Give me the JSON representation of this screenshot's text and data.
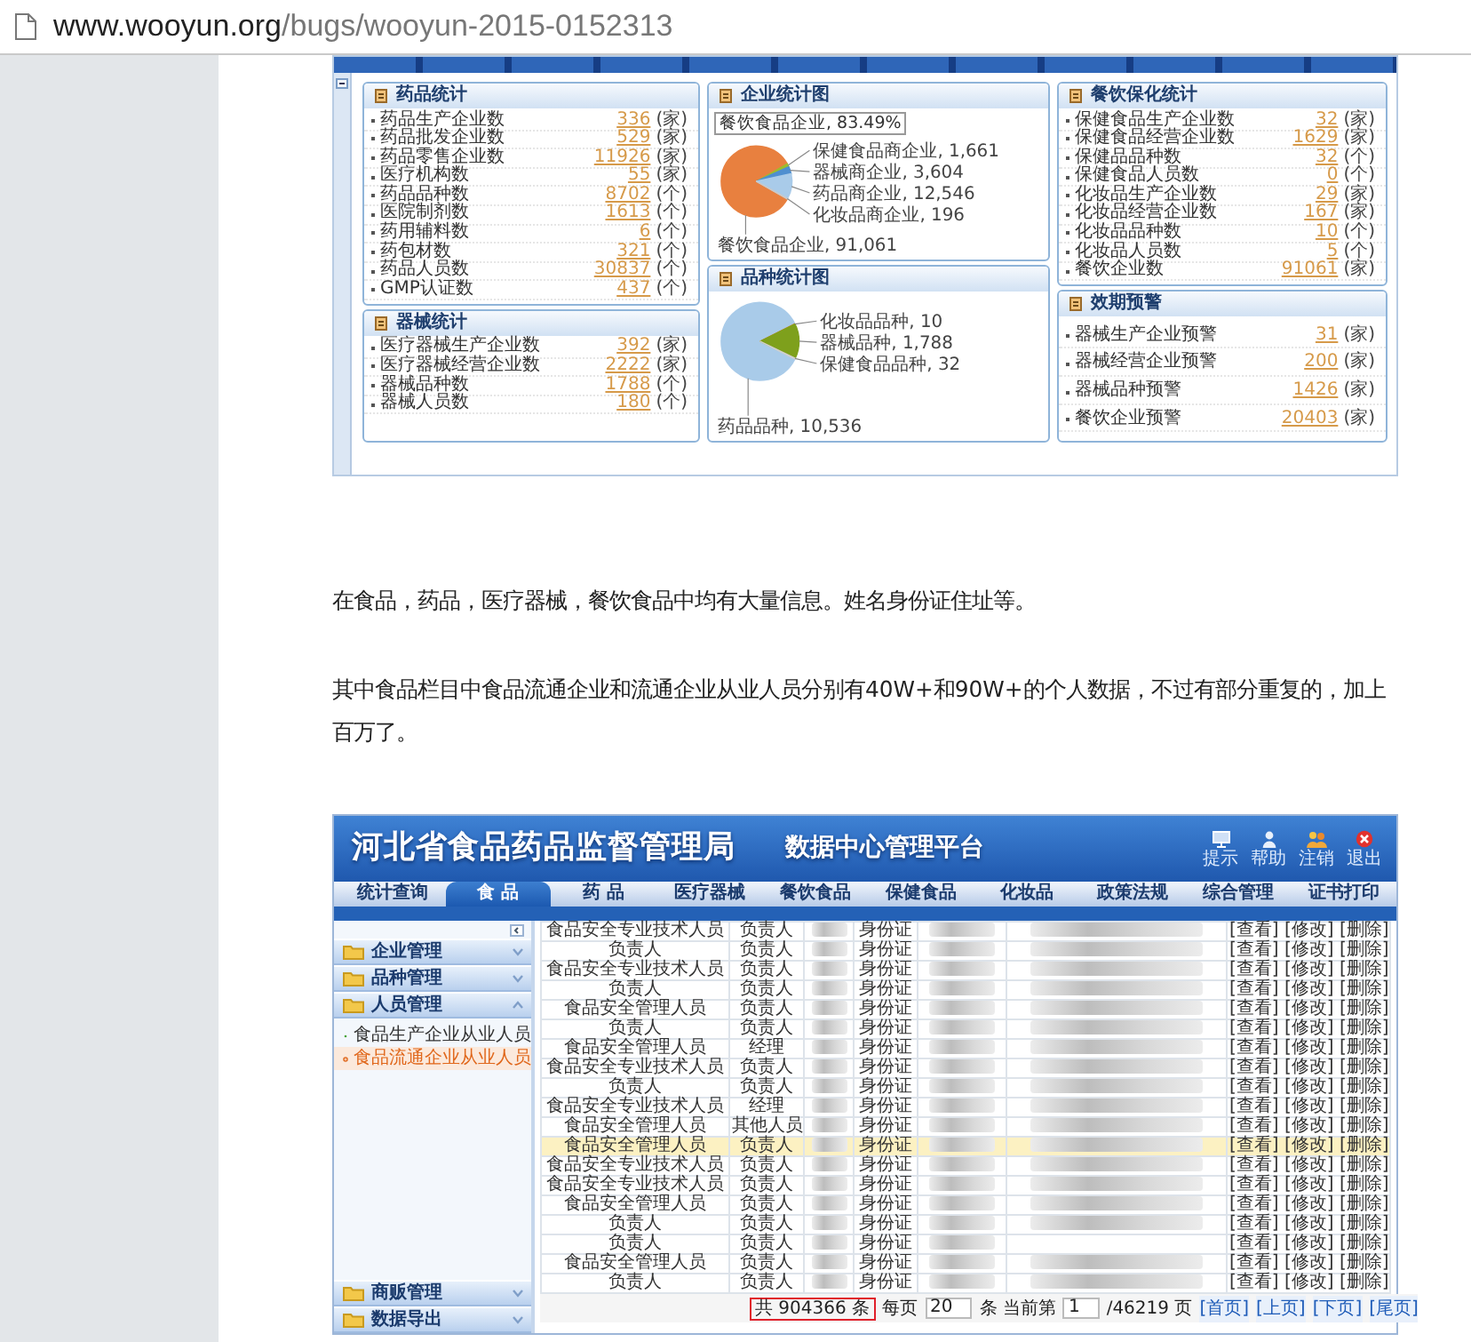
{
  "browser": {
    "host": "www.wooyun.org",
    "path": "/bugs/wooyun-2015-0152313"
  },
  "dashboard": {
    "columns": [
      [
        {
          "kind": "stats",
          "title": "药品统计",
          "rows": [
            {
              "label": "药品生产企业数",
              "value": "336",
              "unit": "(家)"
            },
            {
              "label": "药品批发企业数",
              "value": "529",
              "unit": "(家)"
            },
            {
              "label": "药品零售企业数",
              "value": "11926",
              "unit": "(家)"
            },
            {
              "label": "医疗机构数",
              "value": "55",
              "unit": "(家)"
            },
            {
              "label": "药品品种数",
              "value": "8702",
              "unit": "(个)"
            },
            {
              "label": "医院制剂数",
              "value": "1613",
              "unit": "(个)"
            },
            {
              "label": "药用辅料数",
              "value": "6",
              "unit": "(个)"
            },
            {
              "label": "药包材数",
              "value": "321",
              "unit": "(个)"
            },
            {
              "label": "药品人员数",
              "value": "30837",
              "unit": "(个)"
            },
            {
              "label": "GMP认证数",
              "value": "437",
              "unit": "(个)"
            }
          ]
        },
        {
          "kind": "stats",
          "title": "器械统计",
          "rows": [
            {
              "label": "医疗器械生产企业数",
              "value": "392",
              "unit": "(家)"
            },
            {
              "label": "医疗器械经营企业数",
              "value": "2222",
              "unit": "(家)"
            },
            {
              "label": "器械品种数",
              "value": "1788",
              "unit": "(个)"
            },
            {
              "label": "器械人员数",
              "value": "180",
              "unit": "(个)"
            }
          ]
        }
      ],
      [
        {
          "kind": "chart",
          "chart_data": {
            "type": "pie",
            "title": "企业统计图",
            "values": [
              91061,
              1661,
              3604,
              12546,
              196
            ],
            "value_labels": [
              "餐饮食品企业, 91,061",
              "保健食品商企业, 1,661",
              "器械商企业, 3,604",
              "药品商企业, 12,546",
              "化妆品商企业, 196"
            ],
            "annotations": [
              "餐饮食品企业, 83.49%"
            ]
          }
        },
        {
          "kind": "chart",
          "chart_data": {
            "type": "pie",
            "title": "品种统计图",
            "values": [
              10536,
              10,
              1788,
              32
            ],
            "value_labels": [
              "药品品种, 10,536",
              "化妆品品种, 10",
              "器械品种, 1,788",
              "保健食品品种, 32"
            ]
          }
        }
      ],
      [
        {
          "kind": "stats",
          "title": "餐饮保化统计",
          "rows": [
            {
              "label": "保健食品生产企业数",
              "value": "32",
              "unit": "(家)"
            },
            {
              "label": "保健食品经营企业数",
              "value": "1629",
              "unit": "(家)"
            },
            {
              "label": "保健品品种数",
              "value": "32",
              "unit": "(个)"
            },
            {
              "label": "保健食品人员数",
              "value": "0",
              "unit": "(个)"
            },
            {
              "label": "化妆品生产企业数",
              "value": "29",
              "unit": "(家)"
            },
            {
              "label": "化妆品经营企业数",
              "value": "167",
              "unit": "(家)"
            },
            {
              "label": "化妆品品种数",
              "value": "10",
              "unit": "(个)"
            },
            {
              "label": "化妆品人员数",
              "value": "5",
              "unit": "(个)"
            },
            {
              "label": "餐饮企业数",
              "value": "91061",
              "unit": "(家)"
            }
          ]
        },
        {
          "kind": "alerts",
          "title": "效期预警",
          "rows": [
            {
              "label": "器械生产企业预警",
              "value": "31",
              "unit": "(家)"
            },
            {
              "label": "器械经营企业预警",
              "value": "200",
              "unit": "(家)"
            },
            {
              "label": "器械品种预警",
              "value": "1426",
              "unit": "(家)"
            },
            {
              "label": "餐饮企业预警",
              "value": "20403",
              "unit": "(家)"
            }
          ]
        }
      ]
    ]
  },
  "paragraphs": [
    {
      "lines": [
        "在食品，药品，医疗器械，餐饮食品中均有大量信息。姓名身份证住址等。"
      ]
    },
    {
      "lines": [
        "其中食品栏目中食品流通企业和流通企业从业人员分别有40W+和90W+的个人数据，不过有部分重复的，加上",
        "百万了。"
      ]
    }
  ],
  "admin": {
    "title": "河北省食品药品监督管理局",
    "subtitle": "数据中心管理平台",
    "header_actions": [
      {
        "kind": "tip",
        "label": "提示"
      },
      {
        "kind": "help",
        "label": "帮助"
      },
      {
        "kind": "logout",
        "label": "注销"
      },
      {
        "kind": "exit",
        "label": "退出"
      }
    ],
    "nav": [
      {
        "label": "统计查询",
        "selected": false
      },
      {
        "label": "食 品",
        "selected": true
      },
      {
        "label": "药 品",
        "selected": false
      },
      {
        "label": "医疗器械",
        "selected": false
      },
      {
        "label": "餐饮食品",
        "selected": false
      },
      {
        "label": "保健食品",
        "selected": false
      },
      {
        "label": "化妆品",
        "selected": false
      },
      {
        "label": "政策法规",
        "selected": false
      },
      {
        "label": "综合管理",
        "selected": false
      },
      {
        "label": "证书打印",
        "selected": false
      }
    ],
    "sidebar": [
      {
        "label": "企业管理",
        "expanded": false
      },
      {
        "label": "品种管理",
        "expanded": false
      },
      {
        "label": "人员管理",
        "expanded": true,
        "children": [
          {
            "label": "食品生产企业从业人员",
            "selected": false
          },
          {
            "label": "食品流通企业从业人员",
            "selected": true
          }
        ]
      },
      {
        "label": "商贩管理",
        "expanded": false
      },
      {
        "label": "数据导出",
        "expanded": false
      }
    ],
    "table": {
      "rows": [
        {
          "column_1": "食品安全专业技术人员",
          "column_2": "负责人",
          "column_3_blurred": true,
          "column_4": "身份证",
          "column_5_blurred": true,
          "column_6_blurred": true,
          "column_7": [
            "[查看]",
            "[修改]",
            "[删除]"
          ],
          "selected": false
        },
        {
          "column_1": "负责人",
          "column_2": "负责人",
          "column_3_blurred": true,
          "column_4": "身份证",
          "column_5_blurred": true,
          "column_6_blurred": true,
          "column_7": [
            "[查看]",
            "[修改]",
            "[删除]"
          ],
          "selected": false
        },
        {
          "column_1": "食品安全专业技术人员",
          "column_2": "负责人",
          "column_3_blurred": true,
          "column_4": "身份证",
          "column_5_blurred": true,
          "column_6_blurred": true,
          "column_7": [
            "[查看]",
            "[修改]",
            "[删除]"
          ],
          "selected": false
        },
        {
          "column_1": "负责人",
          "column_2": "负责人",
          "column_3_blurred": true,
          "column_4": "身份证",
          "column_5_blurred": true,
          "column_6_blurred": true,
          "column_7": [
            "[查看]",
            "[修改]",
            "[删除]"
          ],
          "selected": false
        },
        {
          "column_1": "食品安全管理人员",
          "column_2": "负责人",
          "column_3_blurred": true,
          "column_4": "身份证",
          "column_5_blurred": true,
          "column_6_blurred": true,
          "column_7": [
            "[查看]",
            "[修改]",
            "[删除]"
          ],
          "selected": false
        },
        {
          "column_1": "负责人",
          "column_2": "负责人",
          "column_3_blurred": true,
          "column_4": "身份证",
          "column_5_blurred": true,
          "column_6_blurred": true,
          "column_7": [
            "[查看]",
            "[修改]",
            "[删除]"
          ],
          "selected": false
        },
        {
          "column_1": "食品安全管理人员",
          "column_2": "经理",
          "column_3_blurred": true,
          "column_4": "身份证",
          "column_5_blurred": true,
          "column_6_blurred": true,
          "column_7": [
            "[查看]",
            "[修改]",
            "[删除]"
          ],
          "selected": false
        },
        {
          "column_1": "食品安全专业技术人员",
          "column_2": "负责人",
          "column_3_blurred": true,
          "column_4": "身份证",
          "column_5_blurred": true,
          "column_6_blurred": true,
          "column_7": [
            "[查看]",
            "[修改]",
            "[删除]"
          ],
          "selected": false
        },
        {
          "column_1": "负责人",
          "column_2": "负责人",
          "column_3_blurred": true,
          "column_4": "身份证",
          "column_5_blurred": true,
          "column_6_blurred": true,
          "column_7": [
            "[查看]",
            "[修改]",
            "[删除]"
          ],
          "selected": false
        },
        {
          "column_1": "食品安全专业技术人员",
          "column_2": "经理",
          "column_3_blurred": true,
          "column_4": "身份证",
          "column_5_blurred": true,
          "column_6_blurred": true,
          "column_7": [
            "[查看]",
            "[修改]",
            "[删除]"
          ],
          "selected": false
        },
        {
          "column_1": "食品安全管理人员",
          "column_2": "其他人员",
          "column_3_blurred": true,
          "column_4": "身份证",
          "column_5_blurred": true,
          "column_6_blurred": true,
          "column_7": [
            "[查看]",
            "[修改]",
            "[删除]"
          ],
          "selected": false
        },
        {
          "column_1": "食品安全管理人员",
          "column_2": "负责人",
          "column_3_blurred": true,
          "column_4": "身份证",
          "column_5_blurred": true,
          "column_6_blurred": true,
          "column_7": [
            "[查看]",
            "[修改]",
            "[删除]"
          ],
          "selected": true
        },
        {
          "column_1": "食品安全专业技术人员",
          "column_2": "负责人",
          "column_3_blurred": true,
          "column_4": "身份证",
          "column_5_blurred": true,
          "column_6_blurred": true,
          "column_7": [
            "[查看]",
            "[修改]",
            "[删除]"
          ],
          "selected": false
        },
        {
          "column_1": "食品安全专业技术人员",
          "column_2": "负责人",
          "column_3_blurred": true,
          "column_4": "身份证",
          "column_5_blurred": true,
          "column_6_blurred": true,
          "column_7": [
            "[查看]",
            "[修改]",
            "[删除]"
          ],
          "selected": false
        },
        {
          "column_1": "食品安全管理人员",
          "column_2": "负责人",
          "column_3_blurred": true,
          "column_4": "身份证",
          "column_5_blurred": true,
          "column_6_blurred": true,
          "column_7": [
            "[查看]",
            "[修改]",
            "[删除]"
          ],
          "selected": false
        },
        {
          "column_1": "负责人",
          "column_2": "负责人",
          "column_3_blurred": true,
          "column_4": "身份证",
          "column_5_blurred": true,
          "column_6_blurred": true,
          "column_7": [
            "[查看]",
            "[修改]",
            "[删除]"
          ],
          "selected": false
        },
        {
          "column_1": "负责人",
          "column_2": "负责人",
          "column_3_blurred": true,
          "column_4": "身份证",
          "column_5_blurred": true,
          "column_6_blurred": false,
          "column_7": [
            "[查看]",
            "[修改]",
            "[删除]"
          ],
          "selected": false
        },
        {
          "column_1": "食品安全管理人员",
          "column_2": "负责人",
          "column_3_blurred": true,
          "column_4": "身份证",
          "column_5_blurred": true,
          "column_6_blurred": true,
          "column_7": [
            "[查看]",
            "[修改]",
            "[删除]"
          ],
          "selected": false
        },
        {
          "column_1": "负责人",
          "column_2": "负责人",
          "column_3_blurred": true,
          "column_4": "身份证",
          "column_5_blurred": true,
          "column_6_blurred": true,
          "column_7": [
            "[查看]",
            "[修改]",
            "[删除]"
          ],
          "selected": false
        }
      ]
    },
    "pager": {
      "total": "共 904366 条",
      "total_boxed": true,
      "per_page_label": "每页",
      "per_page": "20",
      "page_label": "条 当前第",
      "page": "1",
      "page_count": "/46219 页",
      "links": [
        "[首页]",
        "[上页]",
        "[下页]",
        "[尾页]"
      ]
    }
  }
}
